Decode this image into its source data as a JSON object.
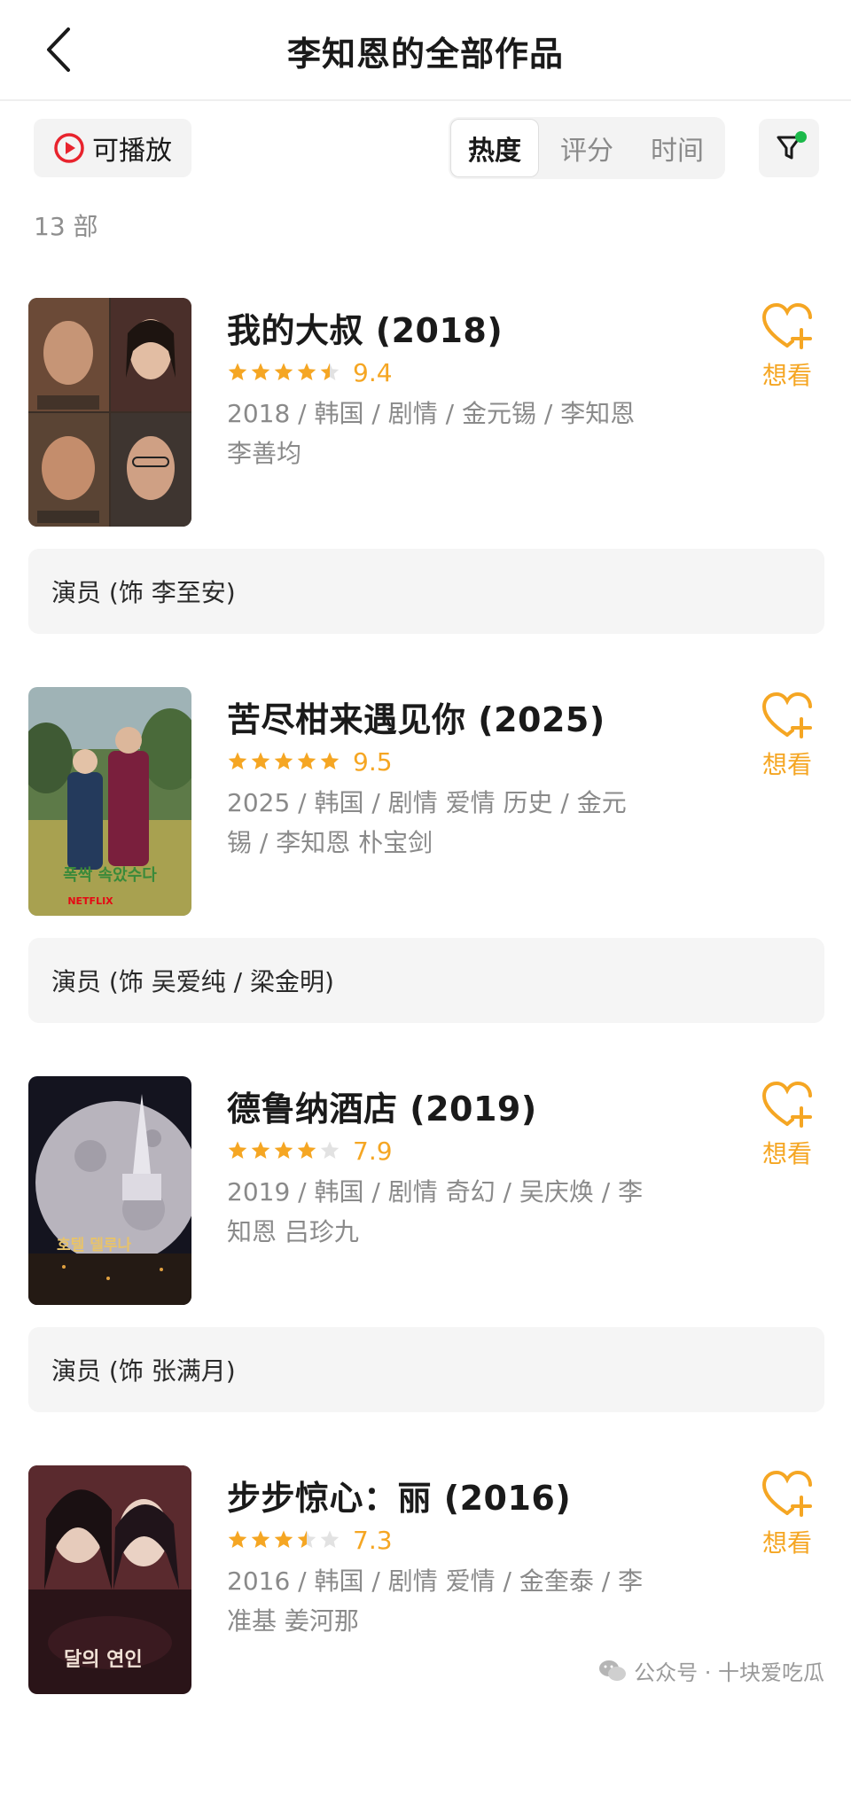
{
  "header": {
    "title": "李知恩的全部作品"
  },
  "toolbar": {
    "playable_label": "可播放",
    "sort_tabs": [
      {
        "label": "热度",
        "active": true
      },
      {
        "label": "评分",
        "active": false
      },
      {
        "label": "时间",
        "active": false
      }
    ],
    "filter_active": true
  },
  "count_label": "13 部",
  "want_label": "想看",
  "movies": [
    {
      "title": "我的大叔 (2018)",
      "score": "9.4",
      "stars": 4.5,
      "meta_line1": "2018 / 韩国 / 剧情 / 金元锡 / 李知恩",
      "meta_line2": "李善均",
      "role": "演员 (饰 李至安)"
    },
    {
      "title": "苦尽柑来遇见你 (2025)",
      "score": "9.5",
      "stars": 5,
      "meta_line1": "2025 / 韩国 / 剧情 爱情 历史 / 金元",
      "meta_line2": "锡 / 李知恩 朴宝剑",
      "role": "演员 (饰 吴爱纯 / 梁金明)",
      "poster_text": "폭싹 속았수다",
      "poster_brand": "NETFLIX"
    },
    {
      "title": "德鲁纳酒店 (2019)",
      "score": "7.9",
      "stars": 4,
      "meta_line1": "2019 / 韩国 / 剧情 奇幻 / 吴庆焕 / 李",
      "meta_line2": "知恩 吕珍九",
      "role": "演员 (饰 张满月)",
      "poster_text": "호텔 델루나"
    },
    {
      "title": "步步惊心：丽 (2016)",
      "score": "7.3",
      "stars": 3.5,
      "meta_line1": "2016 / 韩国 / 剧情 爱情 / 金奎泰 / 李",
      "meta_line2": "准基 姜河那",
      "poster_text": "달의 연인"
    }
  ],
  "watermark": "公众号 · 十块爱吃瓜",
  "colors": {
    "accent": "#f5a623",
    "play_red": "#e8232d",
    "filter_dot": "#1cb94a",
    "meta_gray": "#8a8a8a"
  }
}
